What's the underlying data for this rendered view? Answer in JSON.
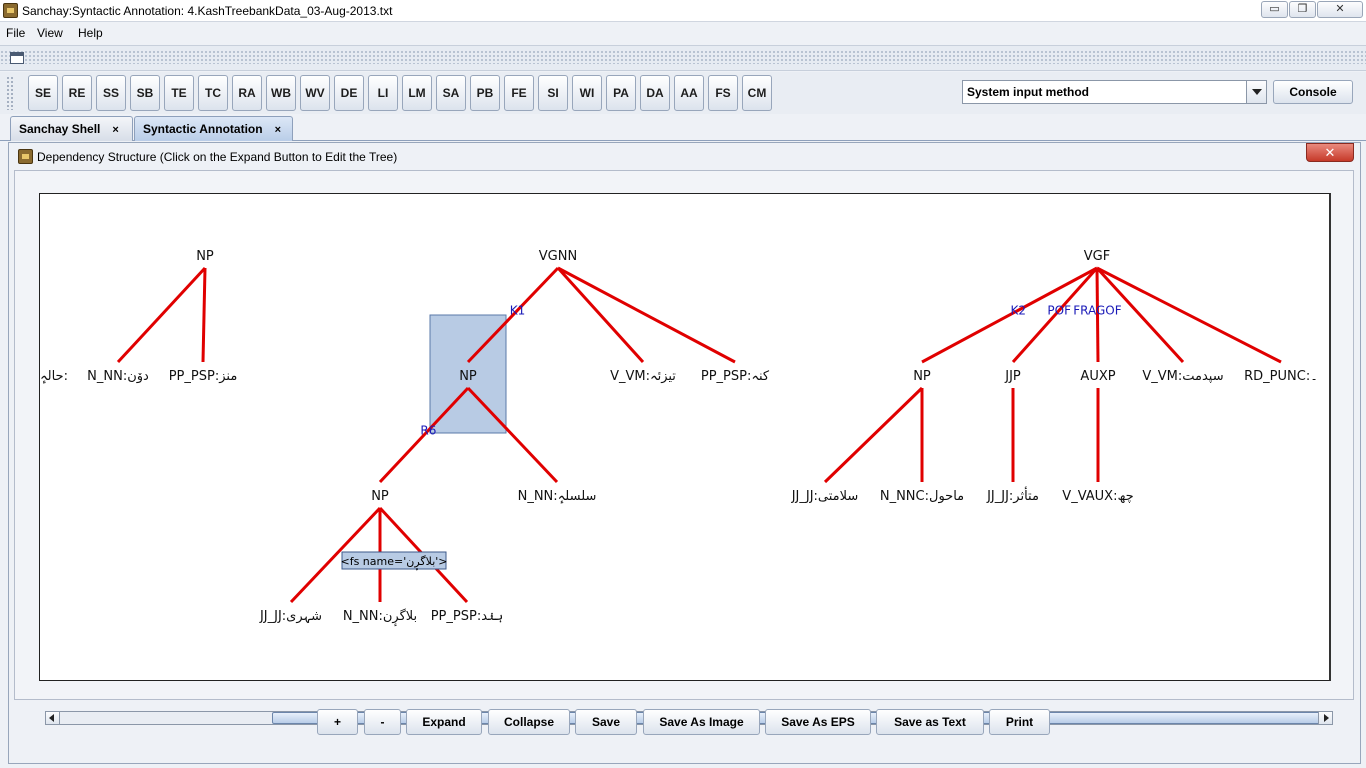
{
  "window": {
    "title": "Sanchay:Syntactic Annotation: 4.KashTreebankData_03-Aug-2013.txt",
    "min_label": "▭",
    "max_label": "❐",
    "close_label": "✕"
  },
  "menu": [
    "File",
    "View",
    "Help"
  ],
  "toolbar": {
    "buttons": [
      "SE",
      "RE",
      "SS",
      "SB",
      "TE",
      "TC",
      "RA",
      "WB",
      "WV",
      "DE",
      "LI",
      "LM",
      "SA",
      "PB",
      "FE",
      "SI",
      "WI",
      "PA",
      "DA",
      "AA",
      "FS",
      "CM"
    ],
    "input_method": "System input method",
    "console_label": "Console"
  },
  "tabs": [
    {
      "label": "Sanchay Shell",
      "close": "×",
      "active": false
    },
    {
      "label": "Syntactic Annotation",
      "close": "×",
      "active": true
    }
  ],
  "panel": {
    "title": "Dependency Structure (Click on the Expand Button to Edit the Tree)",
    "close_label": "✕"
  },
  "tree": {
    "nodes": [
      {
        "id": "np1",
        "label": "NP"
      },
      {
        "id": "hal",
        "label": "حالہٕ:"
      },
      {
        "id": "nn1",
        "label": "N_NN:دوٚن"
      },
      {
        "id": "psp1",
        "label": "PP_PSP:منز"
      },
      {
        "id": "vgnn",
        "label": "VGNN"
      },
      {
        "id": "np2",
        "label": "NP"
      },
      {
        "id": "vm1",
        "label": "V_VM:تیزئہ"
      },
      {
        "id": "psp2",
        "label": "PP_PSP:کنہ"
      },
      {
        "id": "np3",
        "label": "NP"
      },
      {
        "id": "nn2",
        "label": "N_NN:سلسلہٕ"
      },
      {
        "id": "jj1",
        "label": "JJ_JJ:شہری"
      },
      {
        "id": "nn3",
        "label": "N_NN:بلاگرٕن"
      },
      {
        "id": "psp3",
        "label": "PP_PSP:ہنٛد"
      },
      {
        "id": "vgf",
        "label": "VGF"
      },
      {
        "id": "np4",
        "label": "NP"
      },
      {
        "id": "jjp",
        "label": "JJP"
      },
      {
        "id": "auxp",
        "label": "AUXP"
      },
      {
        "id": "vm2",
        "label": "V_VM:سپدمت"
      },
      {
        "id": "punc",
        "label": "RD_PUNC:۔"
      },
      {
        "id": "jj2",
        "label": "JJ_JJ:سلامتی"
      },
      {
        "id": "nnc",
        "label": "N_NNC:ماحول"
      },
      {
        "id": "jj3",
        "label": "JJ_JJ:متأثر"
      },
      {
        "id": "vaux",
        "label": "V_VAUX:چھ"
      }
    ],
    "edges": [
      {
        "from": "np1",
        "to": "nn1"
      },
      {
        "from": "np1",
        "to": "psp1"
      },
      {
        "from": "vgnn",
        "to": "np2",
        "rel": "K1"
      },
      {
        "from": "vgnn",
        "to": "vm1"
      },
      {
        "from": "vgnn",
        "to": "psp2"
      },
      {
        "from": "np2",
        "to": "np3",
        "rel": "R6"
      },
      {
        "from": "np2",
        "to": "nn2"
      },
      {
        "from": "np3",
        "to": "jj1"
      },
      {
        "from": "np3",
        "to": "nn3"
      },
      {
        "from": "np3",
        "to": "psp3"
      },
      {
        "from": "vgf",
        "to": "np4",
        "rel": "K2"
      },
      {
        "from": "vgf",
        "to": "jjp",
        "rel": "POF"
      },
      {
        "from": "vgf",
        "to": "auxp",
        "rel": "FRAGOF"
      },
      {
        "from": "vgf",
        "to": "vm2"
      },
      {
        "from": "vgf",
        "to": "punc"
      },
      {
        "from": "np4",
        "to": "jj2"
      },
      {
        "from": "np4",
        "to": "nnc"
      },
      {
        "from": "jjp",
        "to": "jj3"
      },
      {
        "from": "auxp",
        "to": "vaux"
      }
    ],
    "selected": "np2",
    "tooltip": "<fs name='بلاگرٕن'>",
    "accent": "#e00000",
    "relation_color": "#1a1ab8",
    "selection_color": "#b8cbe4"
  },
  "bottom_buttons": [
    "+",
    "-",
    "Expand",
    "Collapse",
    "Save",
    "Save As Image",
    "Save As EPS",
    "Save as Text",
    "Print"
  ]
}
